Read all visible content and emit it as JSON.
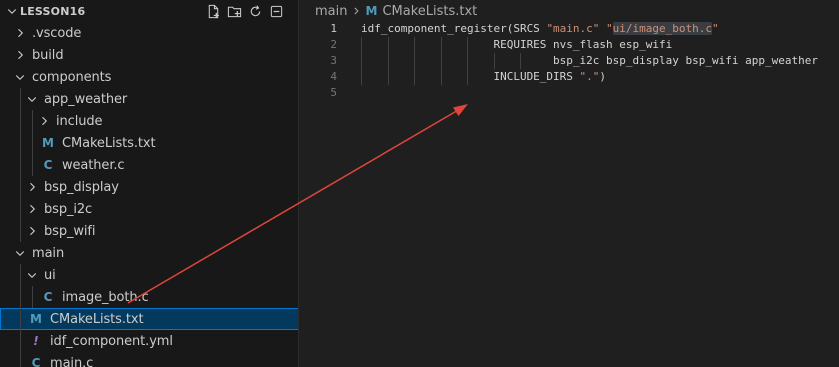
{
  "explorer": {
    "title": "LESSON16",
    "actions": [
      "new-file-icon",
      "new-folder-icon",
      "refresh-icon",
      "collapse-all-icon"
    ]
  },
  "tree": [
    {
      "label": ".vscode",
      "type": "folder",
      "expanded": false,
      "depth": 0,
      "name": "tree-folder-vscode"
    },
    {
      "label": "build",
      "type": "folder",
      "expanded": false,
      "depth": 0,
      "name": "tree-folder-build"
    },
    {
      "label": "components",
      "type": "folder",
      "expanded": true,
      "depth": 0,
      "name": "tree-folder-components"
    },
    {
      "label": "app_weather",
      "type": "folder",
      "expanded": true,
      "depth": 1,
      "name": "tree-folder-app-weather"
    },
    {
      "label": "include",
      "type": "folder",
      "expanded": false,
      "depth": 2,
      "name": "tree-folder-include"
    },
    {
      "label": "CMakeLists.txt",
      "type": "file",
      "glyph": "M",
      "glyphClass": "glyph-m",
      "depth": 2,
      "name": "tree-file-app-weather-cmakelists"
    },
    {
      "label": "weather.c",
      "type": "file",
      "glyph": "C",
      "glyphClass": "glyph-c",
      "depth": 2,
      "name": "tree-file-weather-c"
    },
    {
      "label": "bsp_display",
      "type": "folder",
      "expanded": false,
      "depth": 1,
      "name": "tree-folder-bsp-display"
    },
    {
      "label": "bsp_i2c",
      "type": "folder",
      "expanded": false,
      "depth": 1,
      "name": "tree-folder-bsp-i2c"
    },
    {
      "label": "bsp_wifi",
      "type": "folder",
      "expanded": false,
      "depth": 1,
      "name": "tree-folder-bsp-wifi"
    },
    {
      "label": "main",
      "type": "folder",
      "expanded": true,
      "depth": 0,
      "name": "tree-folder-main"
    },
    {
      "label": "ui",
      "type": "folder",
      "expanded": true,
      "depth": 1,
      "name": "tree-folder-ui"
    },
    {
      "label": "image_both.c",
      "type": "file",
      "glyph": "C",
      "glyphClass": "glyph-c",
      "depth": 2,
      "name": "tree-file-image-both-c"
    },
    {
      "label": "CMakeLists.txt",
      "type": "file",
      "glyph": "M",
      "glyphClass": "glyph-m",
      "depth": 1,
      "selected": true,
      "name": "tree-file-main-cmakelists"
    },
    {
      "label": "idf_component.yml",
      "type": "file",
      "glyph": "!",
      "glyphClass": "glyph-yml",
      "depth": 1,
      "name": "tree-file-idf-component-yml"
    },
    {
      "label": "main.c",
      "type": "file",
      "glyph": "C",
      "glyphClass": "glyph-c",
      "depth": 1,
      "name": "tree-file-main-c"
    }
  ],
  "editor": {
    "breadcrumb": {
      "folder": "main",
      "file_glyph": "M",
      "file": "CMakeLists.txt"
    },
    "lines": [
      {
        "num": "1",
        "active": true,
        "indent": 0,
        "segments": [
          {
            "t": "idf_component_register(SRCS ",
            "c": "kw"
          },
          {
            "t": "\"main.c\"",
            "c": "str"
          },
          {
            "t": " ",
            "c": "kw"
          },
          {
            "t": "\"",
            "c": "str"
          },
          {
            "t": "ui/image_both.c",
            "c": "str hl"
          },
          {
            "t": "\"",
            "c": "str"
          }
        ]
      },
      {
        "num": "2",
        "active": false,
        "indent": 0,
        "segments": [
          {
            "t": "                    REQUIRES nvs_flash esp_wifi",
            "c": "kw"
          }
        ]
      },
      {
        "num": "3",
        "active": false,
        "indent": 0,
        "segments": [
          {
            "t": "                             bsp_i2c bsp_display bsp_wifi app_weather",
            "c": "kw"
          }
        ]
      },
      {
        "num": "4",
        "active": false,
        "indent": 0,
        "segments": [
          {
            "t": "                    INCLUDE_DIRS ",
            "c": "kw"
          },
          {
            "t": "\".\"",
            "c": "str"
          },
          {
            "t": ")",
            "c": "kw"
          }
        ]
      },
      {
        "num": "5",
        "active": false,
        "indent": 0,
        "segments": []
      }
    ]
  },
  "colors": {
    "sidebar_bg": "#181818",
    "editor_bg": "#1f1f1f",
    "selection_bg": "#04395e",
    "selection_border": "#0078d4",
    "string": "#ce9178",
    "cmake_icon": "#519aba",
    "arrow": "#e0453a"
  }
}
